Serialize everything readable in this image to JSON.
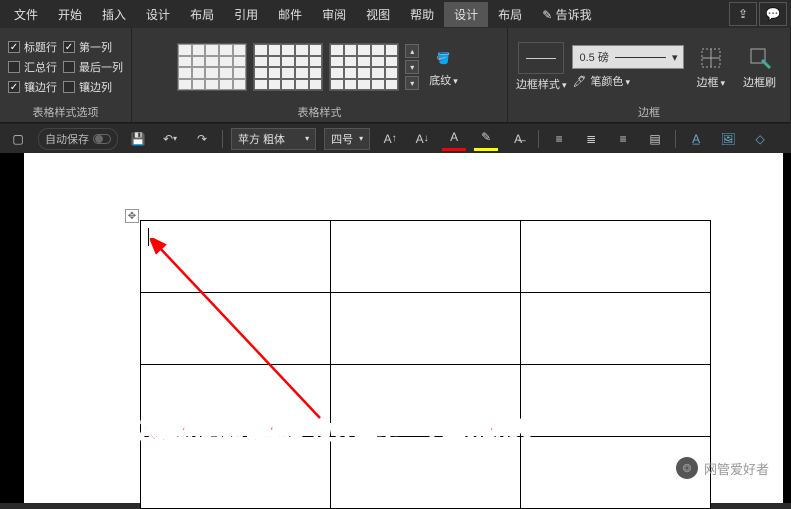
{
  "menu": [
    "文件",
    "开始",
    "插入",
    "设计",
    "布局",
    "引用",
    "邮件",
    "审阅",
    "视图",
    "帮助",
    "设计",
    "布局",
    "告诉我"
  ],
  "menu_active_index": 10,
  "ribbon": {
    "style_options": {
      "label": "表格样式选项",
      "col1": [
        {
          "label": "标题行",
          "checked": true
        },
        {
          "label": "汇总行",
          "checked": false
        },
        {
          "label": "镶边行",
          "checked": true
        }
      ],
      "col2": [
        {
          "label": "第一列",
          "checked": true
        },
        {
          "label": "最后一列",
          "checked": false
        },
        {
          "label": "镶边列",
          "checked": false
        }
      ]
    },
    "table_styles": {
      "label": "表格样式",
      "shading": "底纹"
    },
    "borders": {
      "label": "边框",
      "border_style": "边框样式",
      "weight": "0.5 磅",
      "pen_color": "笔颜色",
      "border_btn": "边框",
      "border_painter": "边框刷"
    }
  },
  "qat": {
    "autosave": "自动保存",
    "font": "苹方 粗体",
    "size": "四号"
  },
  "annotation": "插入表格后将鼠标定位在其中一个单元格内",
  "watermark": "网管爱好者"
}
